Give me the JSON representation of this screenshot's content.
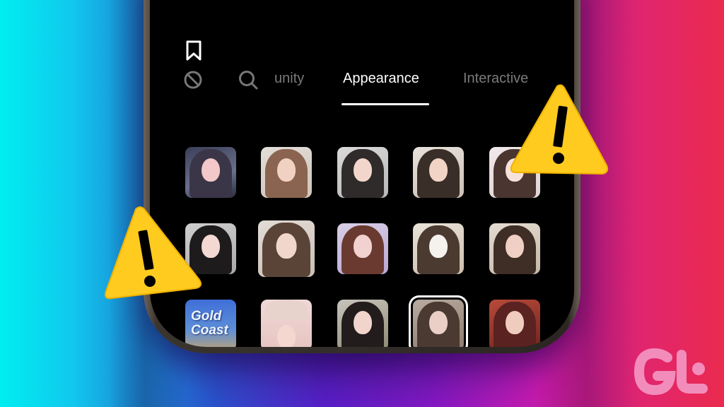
{
  "header": {
    "bookmark_icon": "bookmark-icon"
  },
  "tabs": {
    "icons": [
      "no-effect-icon",
      "search-icon"
    ],
    "items": [
      {
        "label": "unity",
        "active": false
      },
      {
        "label": "Appearance",
        "active": true
      },
      {
        "label": "Interactive",
        "active": false
      }
    ]
  },
  "effects_grid": {
    "rows": [
      [
        {
          "name": "effect-sparkle-girl",
          "selected": false
        },
        {
          "name": "effect-soft-glam",
          "selected": false
        },
        {
          "name": "effect-bob-cut",
          "selected": false
        },
        {
          "name": "effect-natural-look",
          "selected": false
        },
        {
          "name": "effect-cute-doodle",
          "selected": false
        }
      ],
      [
        {
          "name": "effect-uniform",
          "selected": false
        },
        {
          "name": "effect-doll-face",
          "selected": false
        },
        {
          "name": "effect-curly-glam",
          "selected": false
        },
        {
          "name": "effect-face-mask",
          "selected": false
        },
        {
          "name": "effect-short-hair",
          "selected": false
        }
      ],
      [
        {
          "name": "effect-gold-coast",
          "label": "Gold Coast",
          "selected": false
        },
        {
          "name": "effect-bunny-ears",
          "selected": false
        },
        {
          "name": "effect-sparkle-dark",
          "selected": false
        },
        {
          "name": "effect-natural-waves",
          "selected": true
        },
        {
          "name": "effect-red-rose",
          "selected": false
        }
      ]
    ]
  },
  "overlays": {
    "warning_icons": [
      "warning-icon-right",
      "warning-icon-left"
    ],
    "warning_color": "#ffcb1f"
  },
  "branding": {
    "logo": "GT",
    "logo_color": "#f28dbb"
  }
}
